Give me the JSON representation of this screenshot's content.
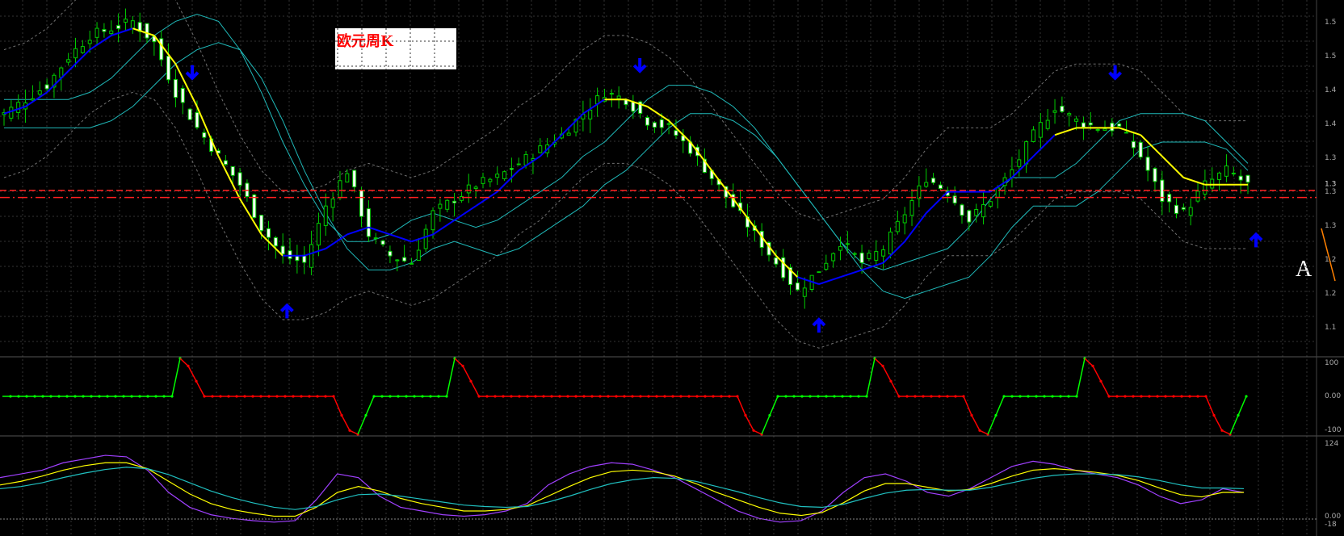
{
  "title": "欧元周K",
  "annotation_label": "A",
  "colors": {
    "background": "#000000",
    "grid": "#333333",
    "bull_candle": "#00cc00",
    "bull_body": "#ffffff",
    "bear_candle": "#00cc00",
    "ma_up": "#0000ff",
    "ma_down": "#ffff00",
    "envelope": "#1fb8b8",
    "bollinger": "#707070",
    "support_line": "#ff2020",
    "arrow": "#0000ff",
    "osc_up": "#00ff00",
    "osc_down": "#ff0000",
    "rsi_purple": "#a040ff",
    "rsi_yellow": "#ffff00",
    "rsi_cyan": "#20c0c0",
    "trend_orange": "#ff8000"
  },
  "chart_data": [
    {
      "type": "candlestick",
      "panel": "price",
      "ylim": [
        1.1,
        1.6
      ],
      "y_ticks": [
        "1.5",
        "1.5",
        "1.4",
        "1.4",
        "1.3",
        "1.3",
        "1.3",
        "1.2",
        "1.2",
        "1.1"
      ],
      "current_price_tag": "1.3",
      "support_levels": [
        1.322,
        1.332
      ],
      "arrows": [
        {
          "direction": "down",
          "x": 0.146
        },
        {
          "direction": "up",
          "x": 0.218
        },
        {
          "direction": "down",
          "x": 0.486
        },
        {
          "direction": "up",
          "x": 0.622
        },
        {
          "direction": "down",
          "x": 0.847
        },
        {
          "direction": "up",
          "x": 0.954
        }
      ],
      "series": [
        {
          "kind": "close",
          "values": [
            1.44,
            1.46,
            1.48,
            1.52,
            1.55,
            1.56,
            1.57,
            1.54,
            1.47,
            1.42,
            1.38,
            1.34,
            1.28,
            1.24,
            1.23,
            1.31,
            1.36,
            1.27,
            1.24,
            1.23,
            1.3,
            1.32,
            1.34,
            1.35,
            1.37,
            1.39,
            1.41,
            1.44,
            1.47,
            1.46,
            1.43,
            1.42,
            1.39,
            1.35,
            1.31,
            1.27,
            1.23,
            1.19,
            1.22,
            1.26,
            1.23,
            1.25,
            1.3,
            1.35,
            1.33,
            1.29,
            1.32,
            1.36,
            1.41,
            1.45,
            1.43,
            1.42,
            1.42,
            1.38,
            1.32,
            1.3,
            1.34,
            1.36,
            1.34
          ]
        },
        {
          "kind": "ma",
          "values": [
            1.44,
            1.45,
            1.47,
            1.5,
            1.53,
            1.55,
            1.56,
            1.55,
            1.51,
            1.45,
            1.38,
            1.32,
            1.27,
            1.24,
            1.24,
            1.25,
            1.27,
            1.28,
            1.27,
            1.26,
            1.27,
            1.29,
            1.31,
            1.33,
            1.36,
            1.38,
            1.41,
            1.44,
            1.46,
            1.46,
            1.45,
            1.43,
            1.4,
            1.36,
            1.32,
            1.28,
            1.24,
            1.21,
            1.2,
            1.21,
            1.22,
            1.23,
            1.26,
            1.3,
            1.33,
            1.33,
            1.33,
            1.35,
            1.38,
            1.41,
            1.42,
            1.42,
            1.42,
            1.41,
            1.38,
            1.35,
            1.34,
            1.34,
            1.34
          ],
          "trend": [
            "up",
            "up",
            "up",
            "up",
            "up",
            "up",
            "up",
            "down",
            "down",
            "down",
            "down",
            "down",
            "down",
            "down",
            "up",
            "up",
            "up",
            "up",
            "up",
            "up",
            "up",
            "up",
            "up",
            "up",
            "up",
            "up",
            "up",
            "up",
            "up",
            "down",
            "down",
            "down",
            "down",
            "down",
            "down",
            "down",
            "down",
            "down",
            "up",
            "up",
            "up",
            "up",
            "up",
            "up",
            "up",
            "up",
            "up",
            "up",
            "up",
            "up",
            "down",
            "down",
            "down",
            "down",
            "down",
            "down",
            "down",
            "down",
            "down"
          ]
        }
      ]
    },
    {
      "type": "line",
      "panel": "oscillator",
      "ylim": [
        -100,
        100
      ],
      "y_ticks": [
        "100",
        "0.00",
        "-100"
      ],
      "series": [
        {
          "name": "",
          "values": [
            0,
            0,
            0,
            0,
            0,
            0,
            0,
            0,
            0,
            0,
            0,
            0,
            0,
            0,
            0,
            0,
            0,
            0,
            0,
            0,
            0,
            0,
            100,
            80,
            40,
            0,
            0,
            0,
            0,
            0,
            0,
            0,
            0,
            0,
            0,
            0,
            0,
            0,
            0,
            0,
            0,
            0,
            -50,
            -90,
            -100,
            -50,
            0,
            0,
            0,
            0,
            0,
            0,
            0,
            0,
            0,
            0,
            100,
            80,
            40,
            0,
            0,
            0,
            0,
            0,
            0,
            0,
            0,
            0,
            0,
            0,
            0,
            0,
            0,
            0,
            0,
            0,
            0,
            0,
            0,
            0,
            0,
            0,
            0,
            0,
            0,
            0,
            0,
            0,
            0,
            0,
            0,
            0,
            -50,
            -90,
            -100,
            -50,
            0,
            0,
            0,
            0,
            0,
            0,
            0,
            0,
            0,
            0,
            0,
            0,
            100,
            80,
            40,
            0,
            0,
            0,
            0,
            0,
            0,
            0,
            0,
            0,
            -50,
            -90,
            -100,
            -50,
            0,
            0,
            0,
            0,
            0,
            0,
            0,
            0,
            0,
            0,
            100,
            80,
            40,
            0,
            0,
            0,
            0,
            0,
            0,
            0,
            0,
            0,
            0,
            0,
            0,
            0,
            -50,
            -90,
            -100,
            -50,
            0
          ]
        }
      ]
    },
    {
      "type": "line",
      "panel": "rsi",
      "ylim": [
        0,
        124
      ],
      "y_ticks": [
        "124",
        "0.00",
        "-18"
      ],
      "series": [
        {
          "name": "",
          "values": [
            70,
            75,
            80,
            90,
            95,
            100,
            98,
            80,
            50,
            30,
            20,
            15,
            12,
            10,
            12,
            40,
            75,
            70,
            45,
            30,
            25,
            20,
            18,
            20,
            25,
            35,
            60,
            75,
            85,
            90,
            88,
            80,
            70,
            55,
            40,
            25,
            15,
            10,
            12,
            25,
            50,
            70,
            75,
            65,
            50,
            45,
            55,
            70,
            85,
            92,
            88,
            80,
            75,
            70,
            60,
            45,
            35,
            40,
            55,
            50
          ]
        },
        {
          "name": "",
          "values": [
            60,
            65,
            72,
            80,
            86,
            90,
            90,
            82,
            65,
            48,
            35,
            27,
            22,
            18,
            18,
            30,
            50,
            58,
            52,
            42,
            35,
            30,
            25,
            25,
            27,
            32,
            45,
            58,
            70,
            78,
            80,
            78,
            72,
            62,
            50,
            40,
            30,
            22,
            19,
            23,
            36,
            52,
            62,
            62,
            57,
            52,
            54,
            62,
            72,
            80,
            82,
            80,
            77,
            73,
            66,
            56,
            47,
            44,
            50,
            50
          ]
        },
        {
          "name": "",
          "values": [
            55,
            58,
            63,
            70,
            76,
            81,
            84,
            82,
            74,
            63,
            52,
            43,
            36,
            30,
            27,
            31,
            40,
            47,
            48,
            45,
            41,
            37,
            33,
            31,
            30,
            31,
            37,
            45,
            54,
            62,
            67,
            70,
            69,
            65,
            58,
            51,
            43,
            36,
            31,
            30,
            34,
            42,
            49,
            53,
            54,
            53,
            53,
            57,
            63,
            69,
            73,
            75,
            75,
            74,
            71,
            66,
            60,
            56,
            56,
            55
          ]
        }
      ]
    }
  ]
}
